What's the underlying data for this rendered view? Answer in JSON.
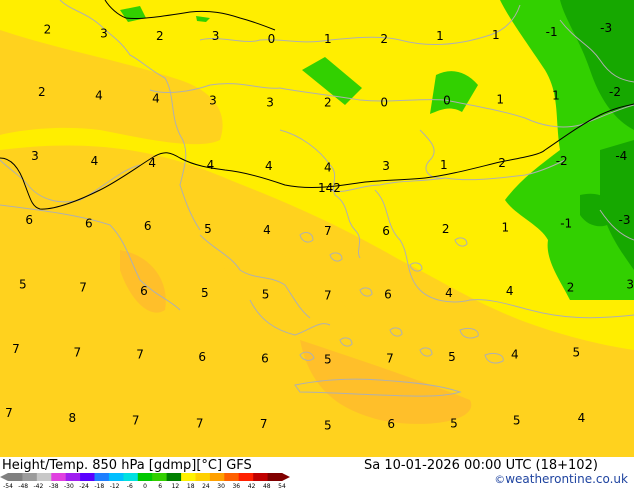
{
  "footer": {
    "left_title": "Height/Temp. 850 hPa [gdmp][°C] GFS",
    "right_title": "Sa 10-01-2026 00:00 UTC (18+102)",
    "credit_symbol": "©",
    "credit_text": "weatherontine.co.uk"
  },
  "colorbar": {
    "ticks": [
      "-54",
      "-48",
      "-42",
      "-38",
      "-30",
      "-24",
      "-18",
      "-12",
      "-6",
      "0",
      "6",
      "12",
      "18",
      "24",
      "30",
      "36",
      "42",
      "48",
      "54"
    ],
    "colors": [
      "#808080",
      "#9c9c9c",
      "#c8c8c8",
      "#e040e0",
      "#a020f0",
      "#5a00ff",
      "#1e7fff",
      "#00bfff",
      "#00e0e0",
      "#00c800",
      "#32d000",
      "#008000",
      "#fff200",
      "#ffd000",
      "#ffa000",
      "#ff6000",
      "#ff2000",
      "#c00000",
      "#800000"
    ]
  },
  "isoline_label": "142",
  "temperature_labels": [
    {
      "text": "2",
      "lon": 0.075,
      "lat": 0.073
    },
    {
      "text": "3",
      "lon": 0.164,
      "lat": 0.082
    },
    {
      "text": "2",
      "lon": 0.252,
      "lat": 0.088
    },
    {
      "text": "3",
      "lon": 0.34,
      "lat": 0.088
    },
    {
      "text": "0",
      "lon": 0.428,
      "lat": 0.094
    },
    {
      "text": "1",
      "lon": 0.517,
      "lat": 0.094
    },
    {
      "text": "2",
      "lon": 0.606,
      "lat": 0.094
    },
    {
      "text": "1",
      "lon": 0.694,
      "lat": 0.088
    },
    {
      "text": "1",
      "lon": 0.782,
      "lat": 0.085
    },
    {
      "text": "-1",
      "lon": 0.87,
      "lat": 0.079
    },
    {
      "text": "-3",
      "lon": 0.956,
      "lat": 0.07
    },
    {
      "text": "2",
      "lon": 0.066,
      "lat": 0.21
    },
    {
      "text": "4",
      "lon": 0.156,
      "lat": 0.218
    },
    {
      "text": "4",
      "lon": 0.246,
      "lat": 0.224
    },
    {
      "text": "3",
      "lon": 0.336,
      "lat": 0.229
    },
    {
      "text": "3",
      "lon": 0.426,
      "lat": 0.233
    },
    {
      "text": "2",
      "lon": 0.517,
      "lat": 0.233
    },
    {
      "text": "0",
      "lon": 0.606,
      "lat": 0.233
    },
    {
      "text": "0",
      "lon": 0.705,
      "lat": 0.229
    },
    {
      "text": "1",
      "lon": 0.789,
      "lat": 0.226
    },
    {
      "text": "1",
      "lon": 0.877,
      "lat": 0.218
    },
    {
      "text": "-2",
      "lon": 0.97,
      "lat": 0.21
    },
    {
      "text": "3",
      "lon": 0.055,
      "lat": 0.35
    },
    {
      "text": "4",
      "lon": 0.149,
      "lat": 0.361
    },
    {
      "text": "4",
      "lon": 0.24,
      "lat": 0.365
    },
    {
      "text": "4",
      "lon": 0.332,
      "lat": 0.37
    },
    {
      "text": "4",
      "lon": 0.424,
      "lat": 0.372
    },
    {
      "text": "4",
      "lon": 0.517,
      "lat": 0.375
    },
    {
      "text": "3",
      "lon": 0.609,
      "lat": 0.372
    },
    {
      "text": "1",
      "lon": 0.7,
      "lat": 0.37
    },
    {
      "text": "2",
      "lon": 0.792,
      "lat": 0.365
    },
    {
      "text": "-2",
      "lon": 0.886,
      "lat": 0.361
    },
    {
      "text": "-4",
      "lon": 0.98,
      "lat": 0.35
    },
    {
      "text": "6",
      "lon": 0.046,
      "lat": 0.49
    },
    {
      "text": "6",
      "lon": 0.14,
      "lat": 0.498
    },
    {
      "text": "6",
      "lon": 0.233,
      "lat": 0.503
    },
    {
      "text": "5",
      "lon": 0.328,
      "lat": 0.51
    },
    {
      "text": "4",
      "lon": 0.421,
      "lat": 0.512
    },
    {
      "text": "7",
      "lon": 0.517,
      "lat": 0.514
    },
    {
      "text": "6",
      "lon": 0.609,
      "lat": 0.514
    },
    {
      "text": "2",
      "lon": 0.703,
      "lat": 0.51
    },
    {
      "text": "1",
      "lon": 0.797,
      "lat": 0.507
    },
    {
      "text": "-1",
      "lon": 0.893,
      "lat": 0.498
    },
    {
      "text": "-3",
      "lon": 0.985,
      "lat": 0.49
    },
    {
      "text": "5",
      "lon": 0.036,
      "lat": 0.631
    },
    {
      "text": "7",
      "lon": 0.131,
      "lat": 0.638
    },
    {
      "text": "6",
      "lon": 0.227,
      "lat": 0.646
    },
    {
      "text": "5",
      "lon": 0.323,
      "lat": 0.65
    },
    {
      "text": "5",
      "lon": 0.419,
      "lat": 0.653
    },
    {
      "text": "7",
      "lon": 0.517,
      "lat": 0.655
    },
    {
      "text": "6",
      "lon": 0.612,
      "lat": 0.653
    },
    {
      "text": "4",
      "lon": 0.708,
      "lat": 0.65
    },
    {
      "text": "4",
      "lon": 0.804,
      "lat": 0.646
    },
    {
      "text": "2",
      "lon": 0.9,
      "lat": 0.638
    },
    {
      "text": "3",
      "lon": 0.994,
      "lat": 0.631
    },
    {
      "text": "7",
      "lon": 0.025,
      "lat": 0.772
    },
    {
      "text": "7",
      "lon": 0.122,
      "lat": 0.78
    },
    {
      "text": "7",
      "lon": 0.221,
      "lat": 0.785
    },
    {
      "text": "6",
      "lon": 0.319,
      "lat": 0.79
    },
    {
      "text": "6",
      "lon": 0.418,
      "lat": 0.793
    },
    {
      "text": "5",
      "lon": 0.517,
      "lat": 0.795
    },
    {
      "text": "7",
      "lon": 0.615,
      "lat": 0.793
    },
    {
      "text": "5",
      "lon": 0.713,
      "lat": 0.79
    },
    {
      "text": "4",
      "lon": 0.812,
      "lat": 0.785
    },
    {
      "text": "5",
      "lon": 0.909,
      "lat": 0.78
    },
    {
      "text": "7",
      "lon": 0.014,
      "lat": 0.913
    },
    {
      "text": "8",
      "lon": 0.114,
      "lat": 0.923
    },
    {
      "text": "7",
      "lon": 0.214,
      "lat": 0.929
    },
    {
      "text": "7",
      "lon": 0.315,
      "lat": 0.935
    },
    {
      "text": "7",
      "lon": 0.416,
      "lat": 0.937
    },
    {
      "text": "5",
      "lon": 0.517,
      "lat": 0.94
    },
    {
      "text": "6",
      "lon": 0.617,
      "lat": 0.937
    },
    {
      "text": "5",
      "lon": 0.716,
      "lat": 0.935
    },
    {
      "text": "5",
      "lon": 0.815,
      "lat": 0.929
    },
    {
      "text": "4",
      "lon": 0.917,
      "lat": 0.923
    }
  ]
}
